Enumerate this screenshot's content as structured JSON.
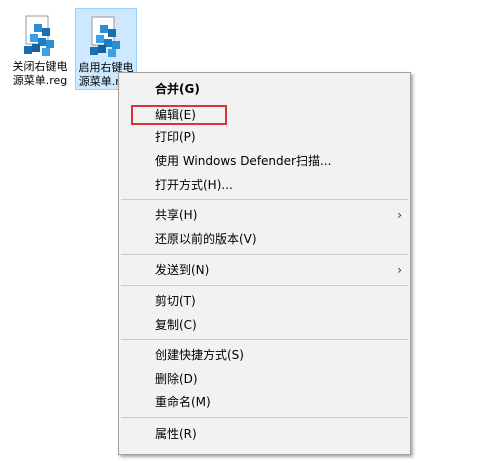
{
  "desktop": {
    "files": [
      {
        "label": "关闭右键电源菜单.reg",
        "selected": false
      },
      {
        "label": "启用右键电源菜单.reg",
        "selected": true
      }
    ],
    "icon_name": "registry-file-icon"
  },
  "context_menu": {
    "groups": [
      [
        {
          "label": "合并(G)",
          "bold": true
        },
        {
          "label": "编辑(E)",
          "highlighted": true
        },
        {
          "label": "打印(P)"
        },
        {
          "label": "使用 Windows Defender扫描..."
        },
        {
          "label": "打开方式(H)..."
        }
      ],
      [
        {
          "label": "共享(H)",
          "submenu": true
        },
        {
          "label": "还原以前的版本(V)"
        }
      ],
      [
        {
          "label": "发送到(N)",
          "submenu": true
        }
      ],
      [
        {
          "label": "剪切(T)"
        },
        {
          "label": "复制(C)"
        }
      ],
      [
        {
          "label": "创建快捷方式(S)"
        },
        {
          "label": "删除(D)"
        },
        {
          "label": "重命名(M)"
        }
      ],
      [
        {
          "label": "属性(R)"
        }
      ]
    ],
    "submenu_arrow": "›",
    "highlight_color": "#d9323c"
  }
}
